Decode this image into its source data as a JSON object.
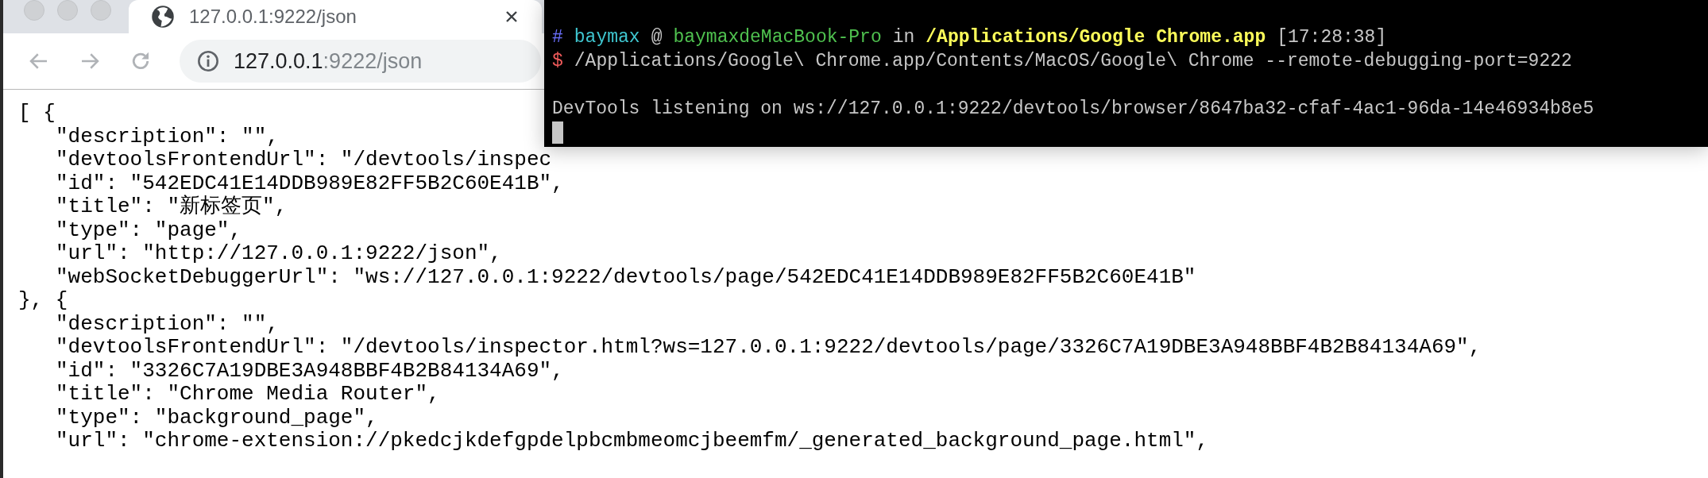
{
  "browser": {
    "tab": {
      "title": "127.0.0.1:9222/json",
      "selected": true
    },
    "address": {
      "host": "127.0.0.1",
      "rest": ":9222/json"
    }
  },
  "json_lines": [
    {
      "kind": "bracket",
      "text": "[ {"
    },
    {
      "kind": "field",
      "text": "\"description\": \"\","
    },
    {
      "kind": "field",
      "text": "\"devtoolsFrontendUrl\": \"/devtools/inspec"
    },
    {
      "kind": "field",
      "text": "\"id\": \"542EDC41E14DDB989E82FF5B2C60E41B\","
    },
    {
      "kind": "field",
      "text": "\"title\": \"新标签页\","
    },
    {
      "kind": "field",
      "text": "\"type\": \"page\","
    },
    {
      "kind": "field",
      "text": "\"url\": \"http://127.0.0.1:9222/json\","
    },
    {
      "kind": "field",
      "text": "\"webSocketDebuggerUrl\": \"ws://127.0.0.1:9222/devtools/page/542EDC41E14DDB989E82FF5B2C60E41B\""
    },
    {
      "kind": "bracket",
      "text": "}, {"
    },
    {
      "kind": "field",
      "text": "\"description\": \"\","
    },
    {
      "kind": "field",
      "text": "\"devtoolsFrontendUrl\": \"/devtools/inspector.html?ws=127.0.0.1:9222/devtools/page/3326C7A19DBE3A948BBF4B2B84134A69\","
    },
    {
      "kind": "field",
      "text": "\"id\": \"3326C7A19DBE3A948BBF4B2B84134A69\","
    },
    {
      "kind": "field",
      "text": "\"title\": \"Chrome Media Router\","
    },
    {
      "kind": "field",
      "text": "\"type\": \"background_page\","
    },
    {
      "kind": "field",
      "text": "\"url\": \"chrome-extension://pkedcjkdefgpdelpbcmbmeomcjbeemfm/_generated_background_page.html\","
    }
  ],
  "terminal": {
    "prompt": [
      {
        "kind": "symbol",
        "text": "#"
      },
      {
        "kind": "user",
        "text": "baymax"
      },
      {
        "kind": "plain",
        "text": "@"
      },
      {
        "kind": "host",
        "text": "baymaxdeMacBook-Pro"
      },
      {
        "kind": "plain",
        "text": "in"
      },
      {
        "kind": "path",
        "text": "/Applications/Google Chrome.app"
      },
      {
        "kind": "plain",
        "text": "[17:28:38]"
      }
    ],
    "command": {
      "sign": "$",
      "text": "/Applications/Google\\ Chrome.app/Contents/MacOS/Google\\ Chrome --remote-debugging-port=9222"
    },
    "output": "DevTools listening on ws://127.0.0.1:9222/devtools/browser/8647ba32-cfaf-4ac1-96da-14e46934b8e5"
  }
}
